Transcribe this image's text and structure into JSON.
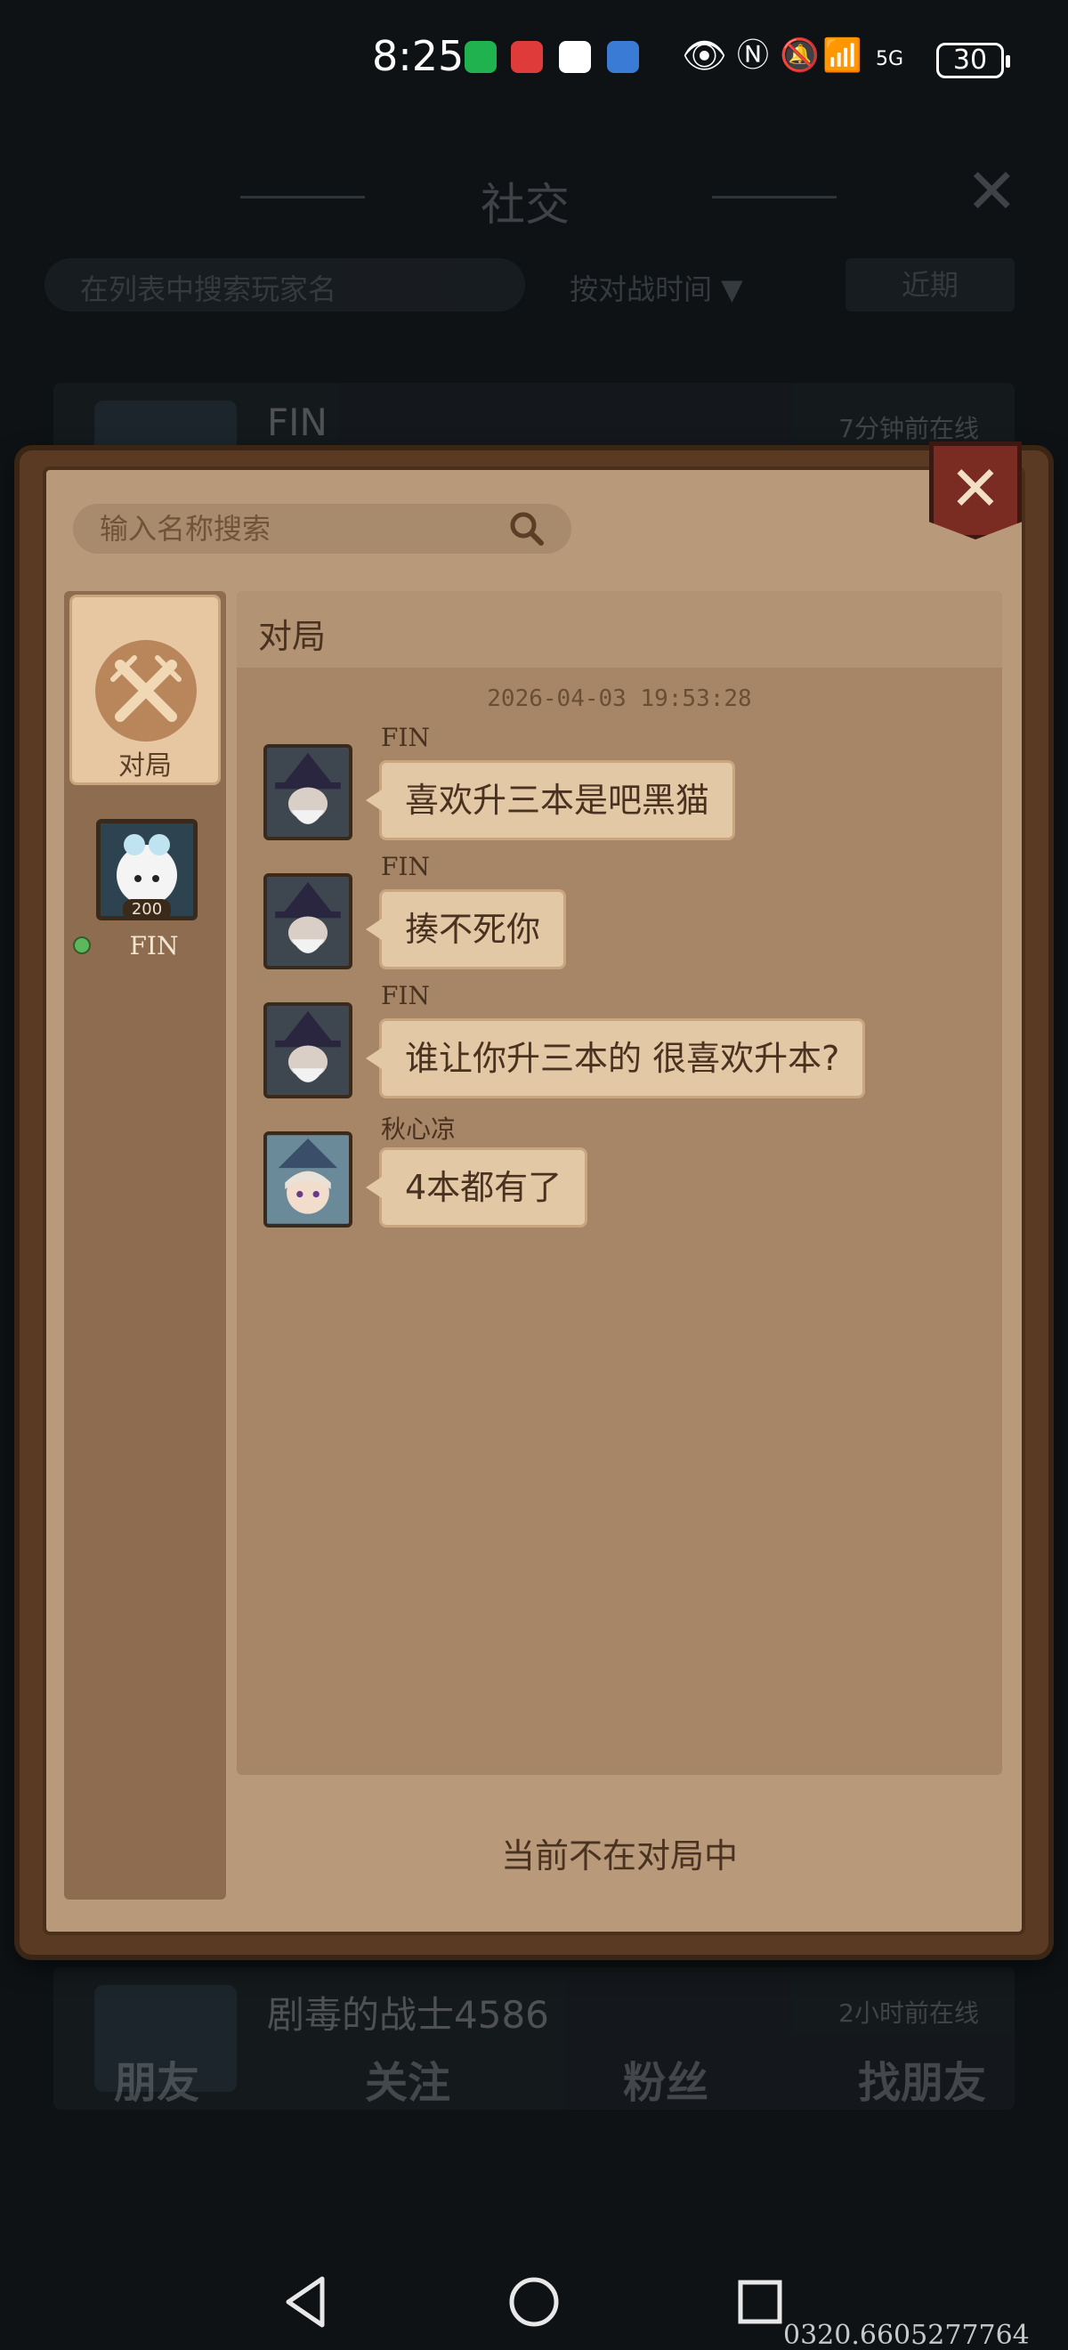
{
  "status_bar": {
    "time": "8:25",
    "battery": "30",
    "network": "5G"
  },
  "background": {
    "title": "社交",
    "search_placeholder": "在列表中搜索玩家名",
    "sort_label": "按对战时间 ▼",
    "recent_label": "近期",
    "rows": [
      {
        "name": "FIN",
        "status": "7分钟前在线"
      },
      {
        "name": "剧毒的战士4586",
        "status": "2小时前在线"
      }
    ],
    "tabs": [
      "朋友",
      "关注",
      "粉丝",
      "找朋友"
    ]
  },
  "modal": {
    "search_placeholder": "输入名称搜索",
    "nav": {
      "match_label": "对局",
      "friend": {
        "name": "FIN",
        "level": "200",
        "online": true
      }
    },
    "chat": {
      "header": "对局",
      "timestamp": "2026-04-03 19:53:28",
      "messages": [
        {
          "sender": "FIN",
          "text": "喜欢升三本是吧黑猫"
        },
        {
          "sender": "FIN",
          "text": "揍不死你"
        },
        {
          "sender": "FIN",
          "text": "谁让你升三本的 很喜欢升本?"
        },
        {
          "sender": "秋心凉",
          "text": "4本都有了"
        }
      ]
    },
    "footer_status": "当前不在对局中"
  },
  "watermark": "0320.6605277764",
  "colors": {
    "parchment": "#b8997a",
    "frame": "#5a3a22",
    "bubble": "#e3c8a6",
    "close_button": "#7a2b22",
    "online": "#5cb85c"
  }
}
